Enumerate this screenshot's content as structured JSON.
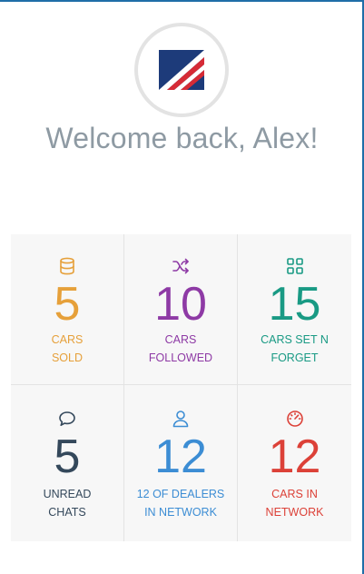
{
  "header": {
    "welcome_text": "Welcome back, Alex!",
    "logo_icon": "dealer-logo-icon"
  },
  "colors": {
    "gold": "#e6a03a",
    "purple": "#8e3aa5",
    "teal": "#199a84",
    "navy": "#34485b",
    "blue": "#3c8dd4",
    "red": "#dc4138"
  },
  "tiles": [
    {
      "icon": "database-icon",
      "value": "5",
      "label": "CARS\nSOLD"
    },
    {
      "icon": "shuffle-icon",
      "value": "10",
      "label": "CARS\nFOLLOWED"
    },
    {
      "icon": "grid-icon",
      "value": "15",
      "label": "CARS SET N\nFORGET"
    },
    {
      "icon": "chat-bubble-icon",
      "value": "5",
      "label": "UNREAD\nCHATS"
    },
    {
      "icon": "user-icon",
      "value": "12",
      "label": "12 OF DEALERS\nIN NETWORK"
    },
    {
      "icon": "speedometer-icon",
      "value": "12",
      "label": "CARS IN\nNETWORK"
    }
  ]
}
